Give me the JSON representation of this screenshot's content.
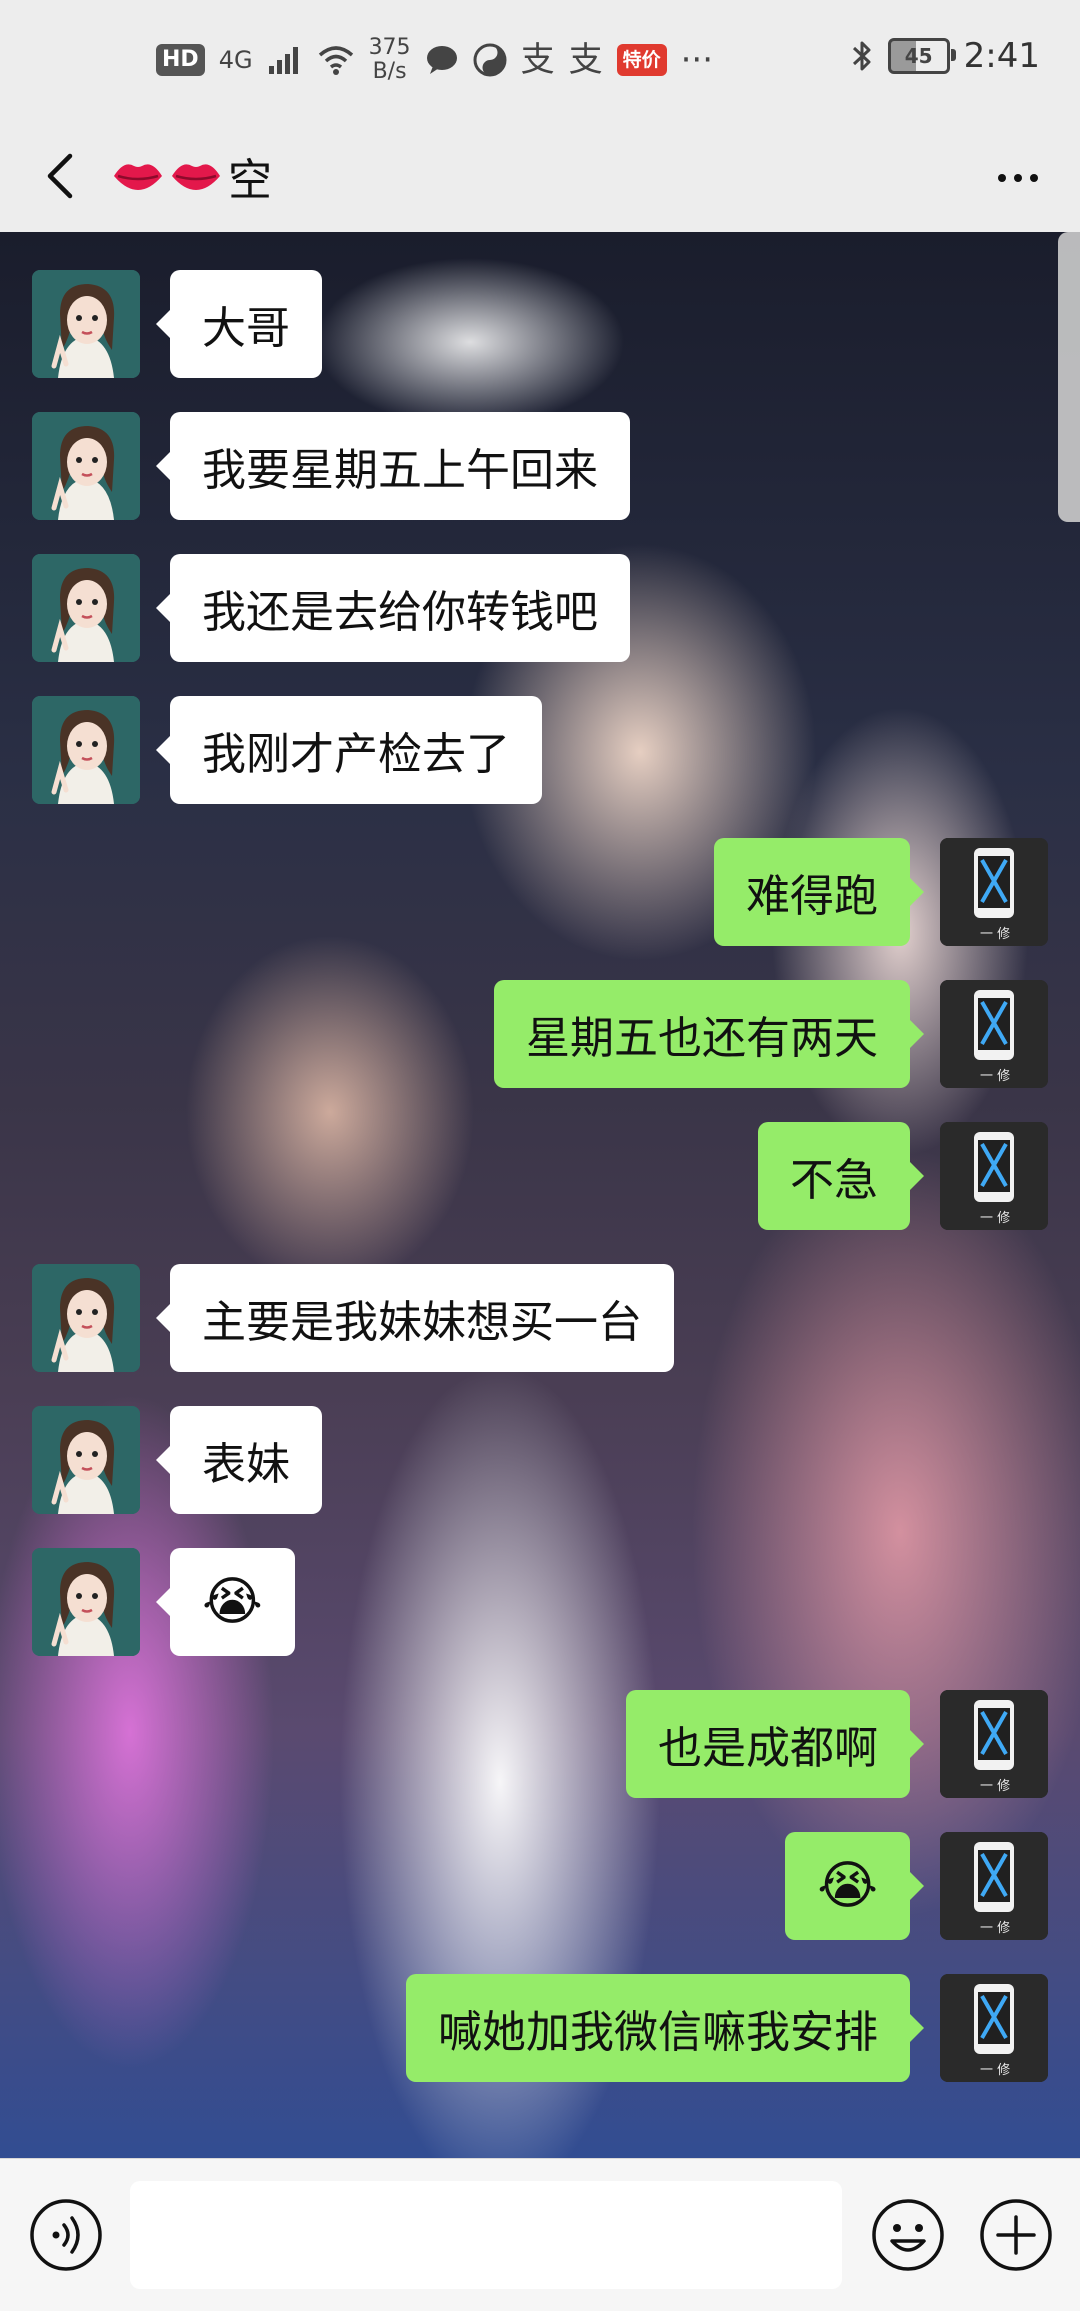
{
  "status_bar": {
    "hd": "HD",
    "network": "4G",
    "speed_value": "375",
    "speed_unit": "B/s",
    "app_badge": "特价",
    "more": "···",
    "battery": "45",
    "time": "2:41"
  },
  "nav": {
    "title": "空",
    "title_icons": [
      "lips-icon",
      "lips-icon"
    ]
  },
  "messages": [
    {
      "side": "left",
      "text": "大哥"
    },
    {
      "side": "left",
      "text": "我要星期五上午回来"
    },
    {
      "side": "left",
      "text": "我还是去给你转钱吧"
    },
    {
      "side": "left",
      "text": "我刚才产检去了"
    },
    {
      "side": "right",
      "text": "难得跑"
    },
    {
      "side": "right",
      "text": "星期五也还有两天"
    },
    {
      "side": "right",
      "text": "不急"
    },
    {
      "side": "left",
      "text": "主要是我妹妹想买一台"
    },
    {
      "side": "left",
      "text": "表妹"
    },
    {
      "side": "left",
      "text": "😭"
    },
    {
      "side": "right",
      "text": "也是成都啊"
    },
    {
      "side": "right",
      "text": "😭"
    },
    {
      "side": "right",
      "text": "喊她加我微信嘛我安排"
    }
  ],
  "input_bar": {
    "placeholder": "",
    "value": ""
  },
  "colors": {
    "bubble_self": "#95ec69",
    "bubble_other": "#ffffff",
    "bar_bg": "#ededed"
  }
}
